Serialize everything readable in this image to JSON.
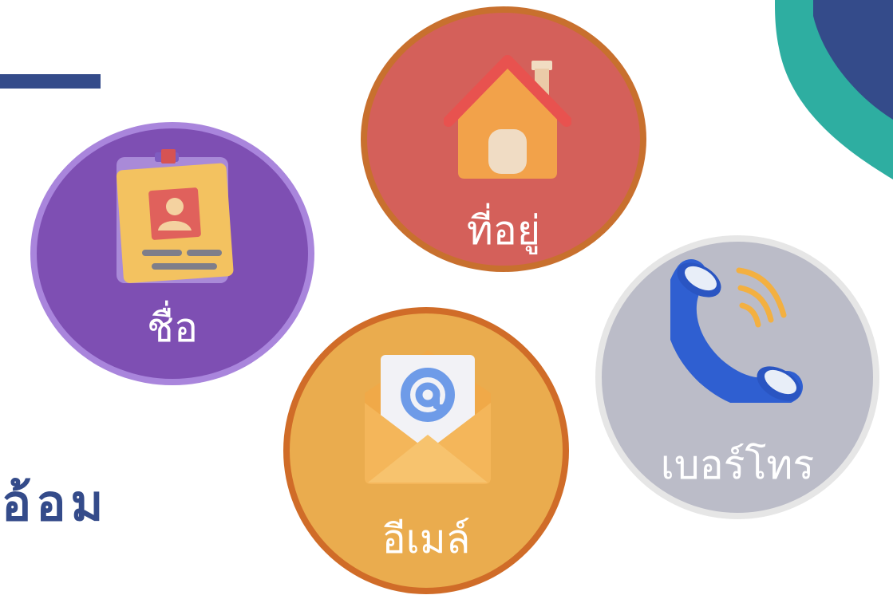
{
  "side_text": "อ้อม",
  "circles": {
    "name": {
      "label": "ชื่อ",
      "icon": "id-card-icon"
    },
    "address": {
      "label": "ที่อยู่",
      "icon": "house-icon"
    },
    "email": {
      "label": "อีเมล์",
      "icon": "envelope-at-icon"
    },
    "phone": {
      "label": "เบอร์โทร",
      "icon": "phone-icon"
    }
  },
  "colors": {
    "navy": "#344b8a",
    "teal": "#2eaea1",
    "name_fill": "#7e4fb3",
    "address_fill": "#d4605a",
    "email_fill": "#eaac4e",
    "phone_fill": "#bbbcc8"
  }
}
